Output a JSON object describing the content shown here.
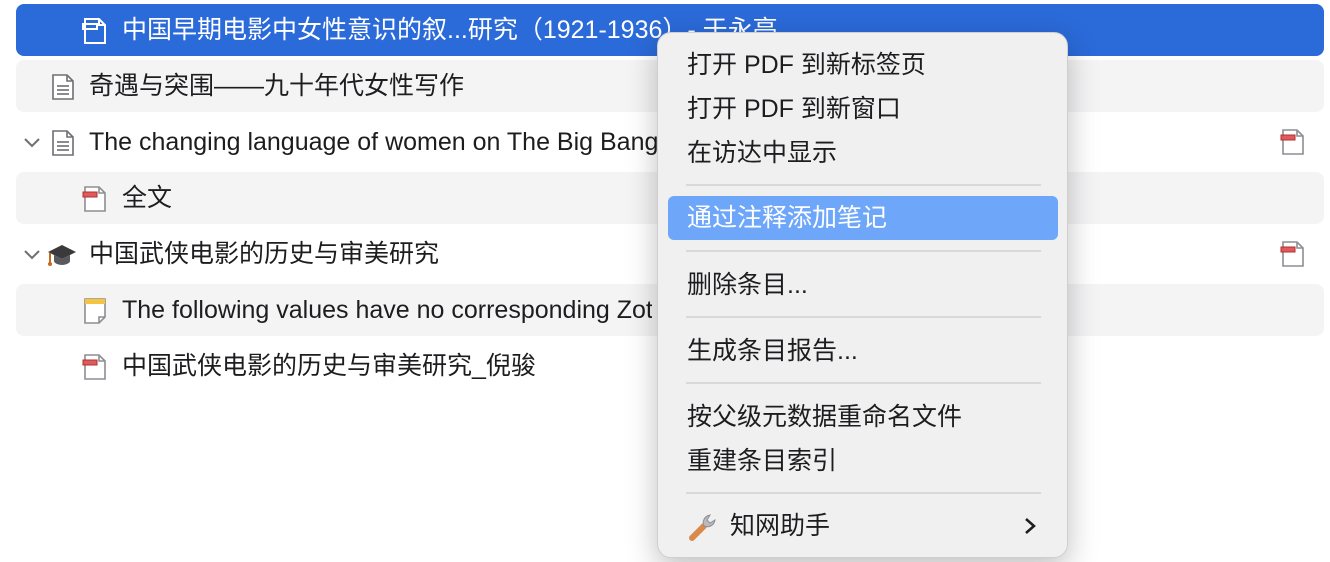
{
  "rows": [
    {
      "title": "中国早期电影中女性意识的叙...研究（1921-1936）- 于永亮"
    },
    {
      "title": "奇遇与突围——九十年代女性写作"
    },
    {
      "title": "The changing language of women on The Big Bang Theory / Blake Jennin"
    },
    {
      "title": "全文"
    },
    {
      "title": "中国武侠电影的历史与审美研究"
    },
    {
      "title": "The following values have no corresponding Zotero field"
    },
    {
      "title": "中国武侠电影的历史与审美研究_倪骏"
    }
  ],
  "menu": {
    "open_pdf_tab": "打开 PDF 到新标签页",
    "open_pdf_window": "打开 PDF 到新窗口",
    "show_in_finder": "在访达中显示",
    "add_note_from_annotations": "通过注释添加笔记",
    "delete_item": "删除条目...",
    "generate_report": "生成条目报告...",
    "rename_from_parent": "按父级元数据重命名文件",
    "reindex_item": "重建条目索引",
    "cnki_helper": "知网助手"
  }
}
